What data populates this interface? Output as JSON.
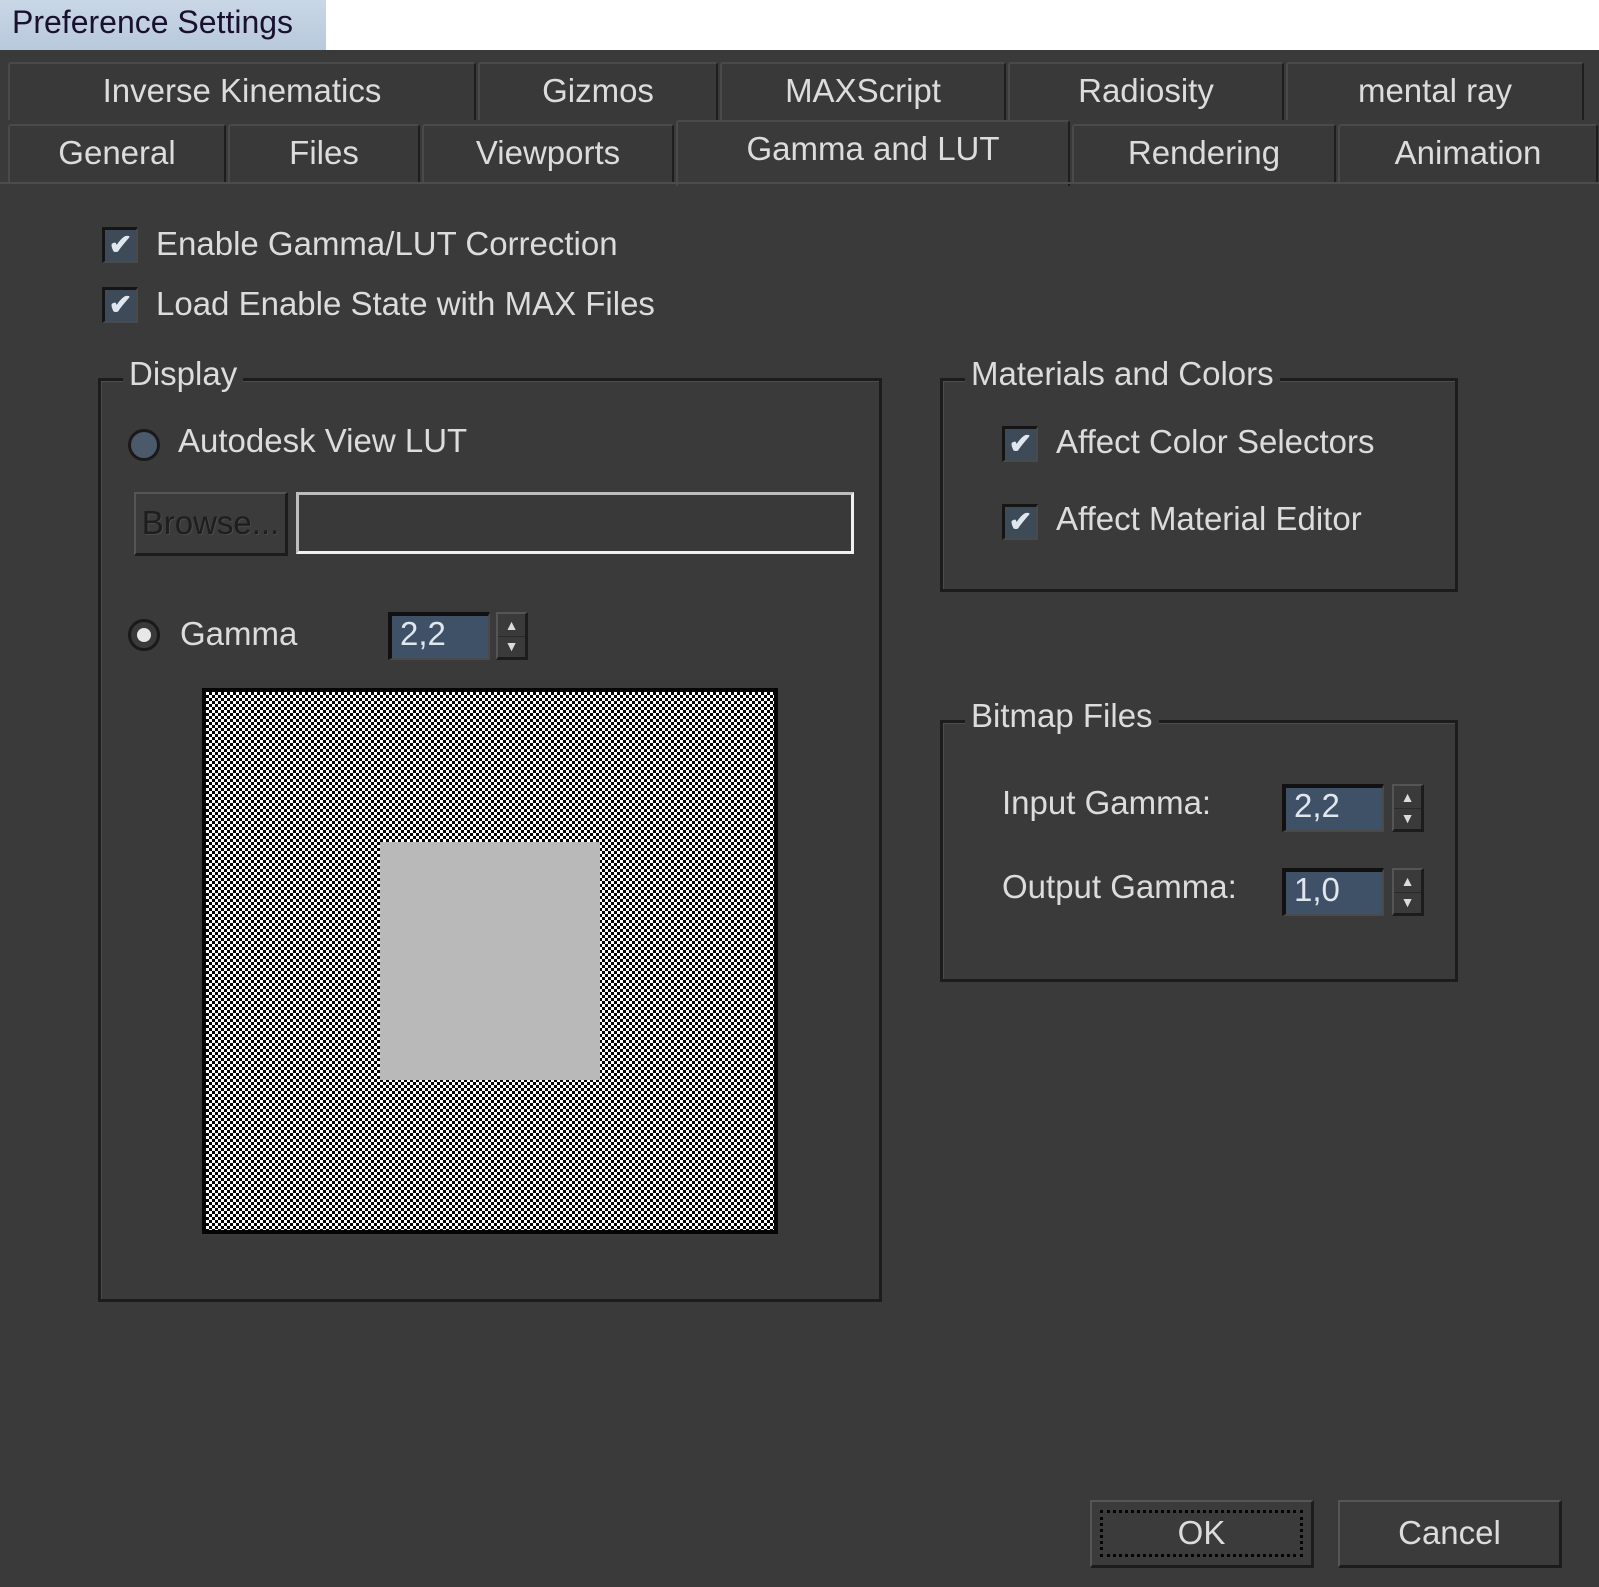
{
  "window": {
    "title": "Preference Settings"
  },
  "tabs": {
    "row_top": [
      {
        "label": "Inverse Kinematics"
      },
      {
        "label": "Gizmos"
      },
      {
        "label": "MAXScript"
      },
      {
        "label": "Radiosity"
      },
      {
        "label": "mental ray"
      }
    ],
    "row_bottom": [
      {
        "label": "General"
      },
      {
        "label": "Files"
      },
      {
        "label": "Viewports"
      },
      {
        "label": "Gamma and LUT",
        "active": true
      },
      {
        "label": "Rendering"
      },
      {
        "label": "Animation"
      }
    ]
  },
  "options": {
    "enable_correction": {
      "label": "Enable Gamma/LUT Correction",
      "checked": true
    },
    "load_enable_state": {
      "label": "Load Enable State with MAX Files",
      "checked": true
    }
  },
  "display": {
    "title": "Display",
    "autodesk_lut": {
      "label": "Autodesk View LUT",
      "selected": false
    },
    "browse_label": "Browse...",
    "lut_path": "",
    "gamma": {
      "label": "Gamma",
      "selected": true,
      "value": "2,2"
    }
  },
  "materials": {
    "title": "Materials and Colors",
    "affect_color_selectors": {
      "label": "Affect Color Selectors",
      "checked": true
    },
    "affect_material_editor": {
      "label": "Affect Material Editor",
      "checked": true
    }
  },
  "bitmap": {
    "title": "Bitmap Files",
    "input_gamma": {
      "label": "Input Gamma:",
      "value": "2,2"
    },
    "output_gamma": {
      "label": "Output Gamma:",
      "value": "1,0"
    }
  },
  "buttons": {
    "ok": "OK",
    "cancel": "Cancel"
  },
  "icons": {
    "check": "✔",
    "spin_up": "▲",
    "spin_down": "▼"
  }
}
